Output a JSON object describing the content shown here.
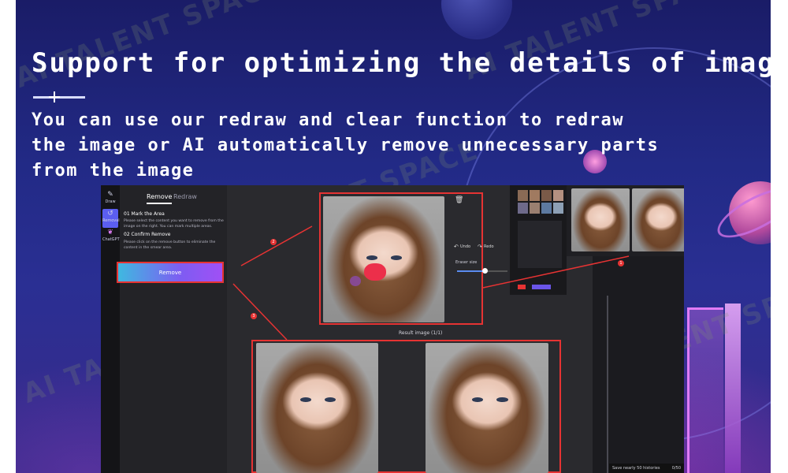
{
  "headline": "Support for optimizing the details of images",
  "subtext": "You can use our redraw and clear function to redraw the image or AI automatically remove unnecessary parts from the image",
  "watermark": "AI TALENT SPACE",
  "app": {
    "rail": [
      {
        "label": "Draw",
        "icon": "brush-icon"
      },
      {
        "label": "Removal",
        "icon": "eraser-icon"
      },
      {
        "label": "ChatGPT",
        "icon": "chat-icon"
      }
    ],
    "tabs": [
      "Remove",
      "Redraw"
    ],
    "step1_title": "01 Mark the Area",
    "step1_desc": "Please select the content you want to remove from the image on the right. You can mark multiple areas.",
    "step2_title": "02 Confirm Remove",
    "step2_desc": "Please click on the remove button to eliminate the content in the smear area.",
    "remove_button": "Remove",
    "undo": "Undo",
    "redo": "Redo",
    "eraser_size_label": "Eraser size",
    "eraser_size_fraction": 0.55,
    "result_label": "Result image (1/1)",
    "histories_text": "Save nearly 50 histories",
    "history_count": "0/50",
    "callouts": [
      "1",
      "2",
      "3"
    ]
  },
  "colors": {
    "accent": "#5b5ef0",
    "highlight": "#e63333",
    "button_gradient_start": "#3fb9e0",
    "button_gradient_end": "#a050f5",
    "neon": "#e07cf5"
  }
}
